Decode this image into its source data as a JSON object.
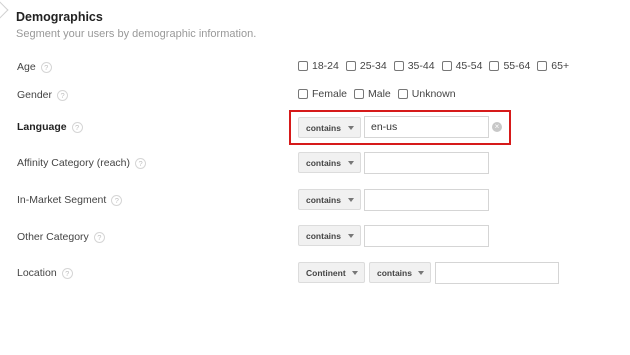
{
  "header": {
    "title": "Demographics",
    "subtitle": "Segment your users by demographic information."
  },
  "help_glyph": "?",
  "clear_glyph": "×",
  "rows": {
    "age": {
      "label": "Age",
      "options": [
        "18-24",
        "25-34",
        "35-44",
        "45-54",
        "55-64",
        "65+"
      ]
    },
    "gender": {
      "label": "Gender",
      "options": [
        "Female",
        "Male",
        "Unknown"
      ]
    },
    "language": {
      "label": "Language",
      "operator": "contains",
      "value": "en-us",
      "highlighted": true,
      "highlight_color": "#d61a1a"
    },
    "affinity": {
      "label": "Affinity Category (reach)",
      "operator": "contains",
      "value": ""
    },
    "in_market": {
      "label": "In-Market Segment",
      "operator": "contains",
      "value": ""
    },
    "other": {
      "label": "Other Category",
      "operator": "contains",
      "value": ""
    },
    "location": {
      "label": "Location",
      "scope": "Continent",
      "operator": "contains",
      "value": ""
    }
  }
}
